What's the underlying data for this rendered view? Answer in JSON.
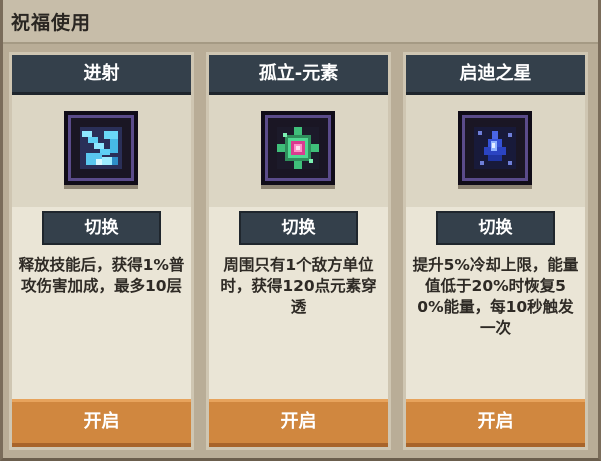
{
  "header": {
    "title": "祝福使用"
  },
  "cards": [
    {
      "title": "进射",
      "icon": "blue-burst-icon",
      "switch_label": "切换",
      "description": "释放技能后，获得1%普攻伤害加成，最多10层",
      "open_label": "开启"
    },
    {
      "title": "孤立-元素",
      "icon": "green-pink-gem-icon",
      "switch_label": "切换",
      "description": "周围只有1个敌方单位时，获得120点元素穿透",
      "open_label": "开启"
    },
    {
      "title": "启迪之星",
      "icon": "blue-star-icon",
      "switch_label": "切换",
      "description": "提升5%冷却上限，能量值低于20%时恢复50%能量，每10秒触发一次",
      "open_label": "开启"
    }
  ],
  "colors": {
    "panel_bg": "#b9ad97",
    "card_bg": "#eae5d6",
    "title_bar": "#34404b",
    "open_button": "#d0873f"
  }
}
